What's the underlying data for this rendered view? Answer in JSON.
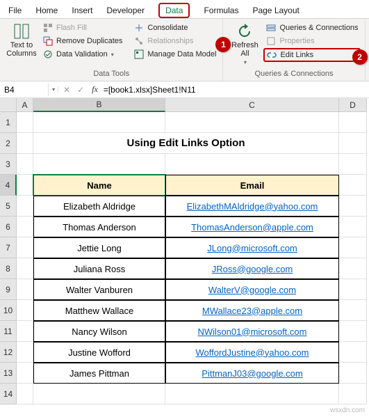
{
  "tabs": {
    "file": "File",
    "home": "Home",
    "insert": "Insert",
    "developer": "Developer",
    "data": "Data",
    "formulas": "Formulas",
    "page_layout": "Page Layout"
  },
  "ribbon": {
    "group_data_tools": "Data Tools",
    "group_queries": "Queries & Connections",
    "text_to_columns": "Text to\nColumns",
    "flash_fill": "Flash Fill",
    "remove_duplicates": "Remove Duplicates",
    "data_validation": "Data Validation",
    "consolidate": "Consolidate",
    "relationships": "Relationships",
    "manage_model": "Manage Data Model",
    "refresh_all": "Refresh\nAll",
    "queries_connections": "Queries & Connections",
    "properties": "Properties",
    "edit_links": "Edit Links"
  },
  "callouts": {
    "one": "1",
    "two": "2"
  },
  "namebox": "B4",
  "formula": "=[book1.xlsx]Sheet1!N11",
  "col_headers": [
    "A",
    "B",
    "C",
    "D"
  ],
  "row_headers": [
    "1",
    "2",
    "3",
    "4",
    "5",
    "6",
    "7",
    "8",
    "9",
    "10",
    "11",
    "12",
    "13",
    "14"
  ],
  "title": "Using Edit Links Option",
  "table": {
    "header": {
      "name": "Name",
      "email": "Email"
    },
    "rows": [
      {
        "name": "Elizabeth Aldridge",
        "email": "ElizabethMAldridge@yahoo.com"
      },
      {
        "name": "Thomas Anderson",
        "email": "ThomasAnderson@apple.com"
      },
      {
        "name": "Jettie Long",
        "email": "JLong@microsoft.com"
      },
      {
        "name": "Juliana Ross",
        "email": "JRoss@google.com"
      },
      {
        "name": "Walter Vanburen",
        "email": "WalterV@google.com"
      },
      {
        "name": "Matthew Wallace",
        "email": "MWallace23@apple.com"
      },
      {
        "name": "Nancy Wilson",
        "email": "NWilson01@microsoft.com"
      },
      {
        "name": "Justine Wofford",
        "email": "WoffordJustine@yahoo.com"
      },
      {
        "name": "James Pittman",
        "email": "PittmanJ03@google.com"
      }
    ]
  },
  "watermark": "wsxdn.com"
}
